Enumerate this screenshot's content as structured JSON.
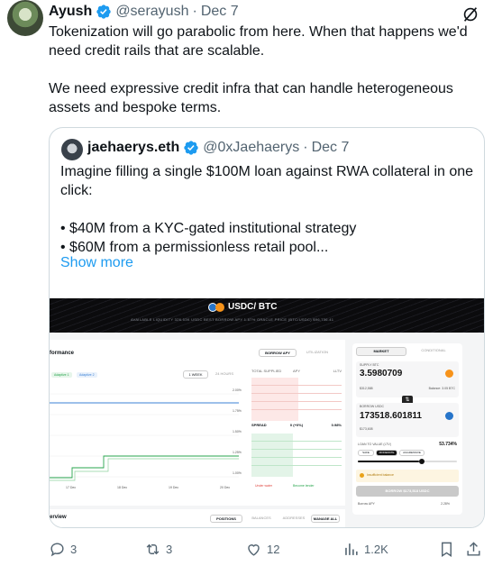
{
  "post": {
    "author_name": "Ayush",
    "handle": "@serayush",
    "separator": "·",
    "date": "Dec 7",
    "text": "Tokenization will go parabolic from here. When that happens we'd need credit rails that are scalable.\n\nWe need expressive credit infra that can handle heterogeneous assets and bespoke terms."
  },
  "quote": {
    "author_name": "jaehaerys.eth",
    "handle": "@0xJaehaerys",
    "separator": "·",
    "date": "Dec 7",
    "text": "Imagine filling a single $100M loan against RWA collateral in one click:\n\n• $40M from a KYC-gated institutional strategy\n• $60M from a permissionless retail pool...",
    "show_more": "Show more"
  },
  "screenshot": {
    "pair_label": "USDC/ BTC",
    "stats_line": "AVAILABLE LIQUIDITY  326.53K USDC    BEST BORROW APY  1.87%    ORACLE PRICE (BTC/USDC)  $96,736.41",
    "performance_label": "formance",
    "tab_borrow_apy": "BORROW APY",
    "tab_utilization": "UTILIZATION",
    "legend_a": "Adaptive 1",
    "legend_b": "Adaptive 2",
    "range_1w": "1 WEEK",
    "range_24h": "24 HOURS",
    "ob_headers": [
      "TOTAL SUPPLIED",
      "APY",
      "LLTV"
    ],
    "spread_label": "SPREAD",
    "spread_value": "0 (+0%)",
    "spread_lltv": "0.98%",
    "x_ticks": [
      "17 Dec",
      "18 Dec",
      "19 Dec",
      "20 Dec"
    ],
    "y_ticks": [
      "2.00%",
      "1.75%",
      "1.50%",
      "1.25%",
      "1.00%"
    ],
    "footer_under_water": "Under water",
    "footer_become_lender": "Become lender",
    "overview_label": "erview",
    "tab_positions": "POSITIONS",
    "tab_balances": "BALANCES",
    "tab_addresses": "ADDRESSES",
    "tab_manage_all": "MANAGE ALL",
    "right_tab_market": "MARKET",
    "right_tab_conditional": "CONDITIONAL",
    "supply_label": "SUPPLY BTC",
    "supply_value": "3.5980709",
    "supply_sub": "$312,588",
    "balance_label": "Balance: 3.05 BTC",
    "borrow_label": "BORROW USDC",
    "borrow_value": "173518.601811",
    "borrow_sub": "$173,608",
    "ltv_label": "LOAN TO VALUE (LTV)",
    "ltv_value": "53.734%",
    "risk_safe": "SAFE",
    "risk_moderate": "MODERATE",
    "risk_aggressive": "AGGRESSIVE",
    "warning_text": "Insufficient balance",
    "cta": "BORROW $173,518 USDC",
    "borrow_apy_label": "Borrow APY",
    "borrow_apy_value": "2.28%"
  },
  "actions": {
    "replies": "3",
    "reposts": "3",
    "likes": "12",
    "views": "1.2K"
  },
  "colors": {
    "link": "#1d9bf0",
    "verified": "#1d9bf0",
    "muted": "#536471",
    "red": "#e0443e",
    "green": "#27a54d"
  }
}
